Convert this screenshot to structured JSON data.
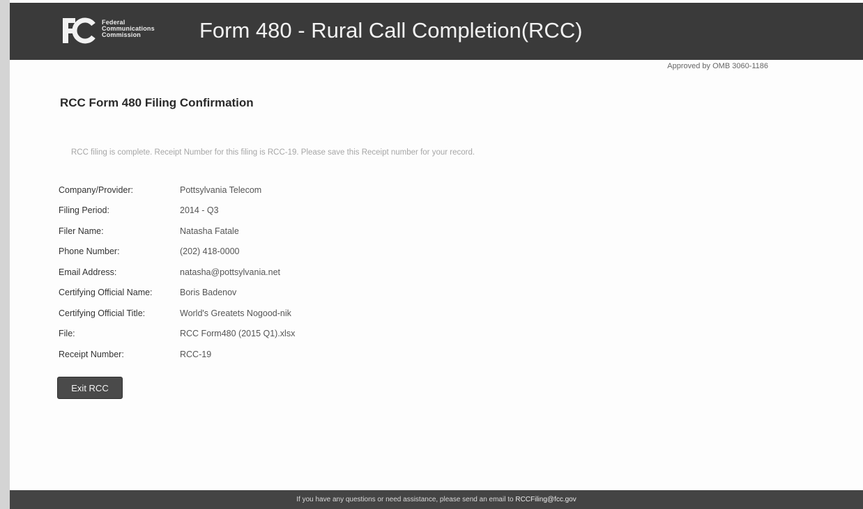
{
  "header": {
    "logo": {
      "mark": "FC",
      "line1": "Federal",
      "line2": "Communications",
      "line3": "Commission"
    },
    "title": "Form 480 - Rural Call Completion(RCC)",
    "omb_notice": "Approved by OMB 3060-1186"
  },
  "main": {
    "page_title": "RCC Form 480 Filing Confirmation",
    "message": "RCC filing is complete. Receipt Number for this filing is RCC-19. Please save this Receipt number for your record.",
    "fields": [
      {
        "label": "Company/Provider:",
        "value": "Pottsylvania Telecom"
      },
      {
        "label": "Filing Period:",
        "value": "2014 - Q3"
      },
      {
        "label": "Filer Name:",
        "value": "Natasha Fatale"
      },
      {
        "label": "Phone Number:",
        "value": "(202) 418-0000"
      },
      {
        "label": "Email Address:",
        "value": "natasha@pottsylvania.net"
      },
      {
        "label": "Certifying Official Name:",
        "value": "Boris Badenov"
      },
      {
        "label": "Certifying Official Title:",
        "value": "World's Greatets Nogood-nik"
      },
      {
        "label": "File:",
        "value": "RCC Form480 (2015 Q1).xlsx"
      },
      {
        "label": "Receipt Number:",
        "value": "RCC-19"
      }
    ],
    "exit_button_label": "Exit RCC"
  },
  "footer": {
    "text": "If you have any questions or need assistance, please send an email to",
    "email": "RCCFiling@fcc.gov"
  },
  "colors": {
    "header_bg": "#3a3a3a",
    "footer_bg": "#444444",
    "button_bg": "#4a4a4a"
  }
}
